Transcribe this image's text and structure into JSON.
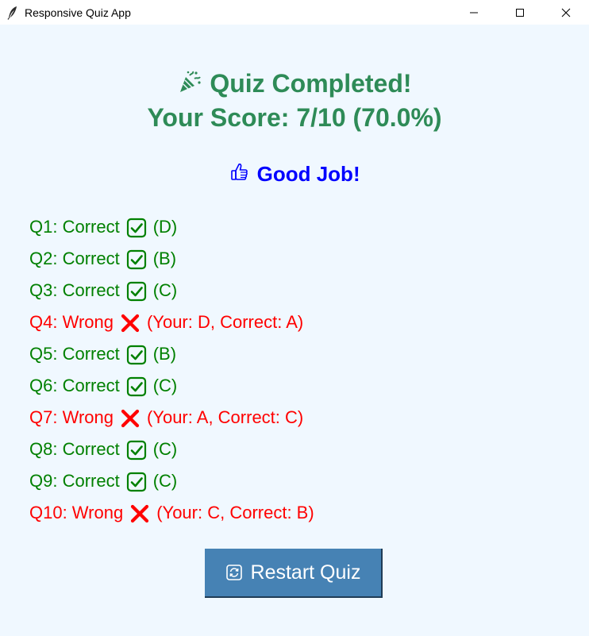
{
  "window": {
    "title": "Responsive Quiz App"
  },
  "header": {
    "line1": "Quiz Completed!",
    "line2": "Your Score: 7/10 (70.0%)",
    "emoji": "party-popper-icon"
  },
  "performance": {
    "label": "Good Job!",
    "emoji": "thumbs-up-icon"
  },
  "results": [
    {
      "id": "Q1",
      "status": "correct",
      "prefix": "Q1: Correct",
      "detail": "(D)"
    },
    {
      "id": "Q2",
      "status": "correct",
      "prefix": "Q2: Correct",
      "detail": "(B)"
    },
    {
      "id": "Q3",
      "status": "correct",
      "prefix": "Q3: Correct",
      "detail": "(C)"
    },
    {
      "id": "Q4",
      "status": "wrong",
      "prefix": "Q4: Wrong",
      "detail": "(Your: D, Correct: A)"
    },
    {
      "id": "Q5",
      "status": "correct",
      "prefix": "Q5: Correct",
      "detail": "(B)"
    },
    {
      "id": "Q6",
      "status": "correct",
      "prefix": "Q6: Correct",
      "detail": "(C)"
    },
    {
      "id": "Q7",
      "status": "wrong",
      "prefix": "Q7: Wrong",
      "detail": "(Your: A, Correct: C)"
    },
    {
      "id": "Q8",
      "status": "correct",
      "prefix": "Q8: Correct",
      "detail": "(C)"
    },
    {
      "id": "Q9",
      "status": "correct",
      "prefix": "Q9: Correct",
      "detail": "(C)"
    },
    {
      "id": "Q10",
      "status": "wrong",
      "prefix": "Q10: Wrong",
      "detail": "(Your: C, Correct: B)"
    }
  ],
  "restart_button": {
    "label": "Restart Quiz"
  },
  "colors": {
    "background": "#f0f8ff",
    "header": "#2e8b57",
    "performance": "#0000ff",
    "correct": "#008000",
    "wrong": "#ff0000",
    "button": "#4682b4"
  }
}
